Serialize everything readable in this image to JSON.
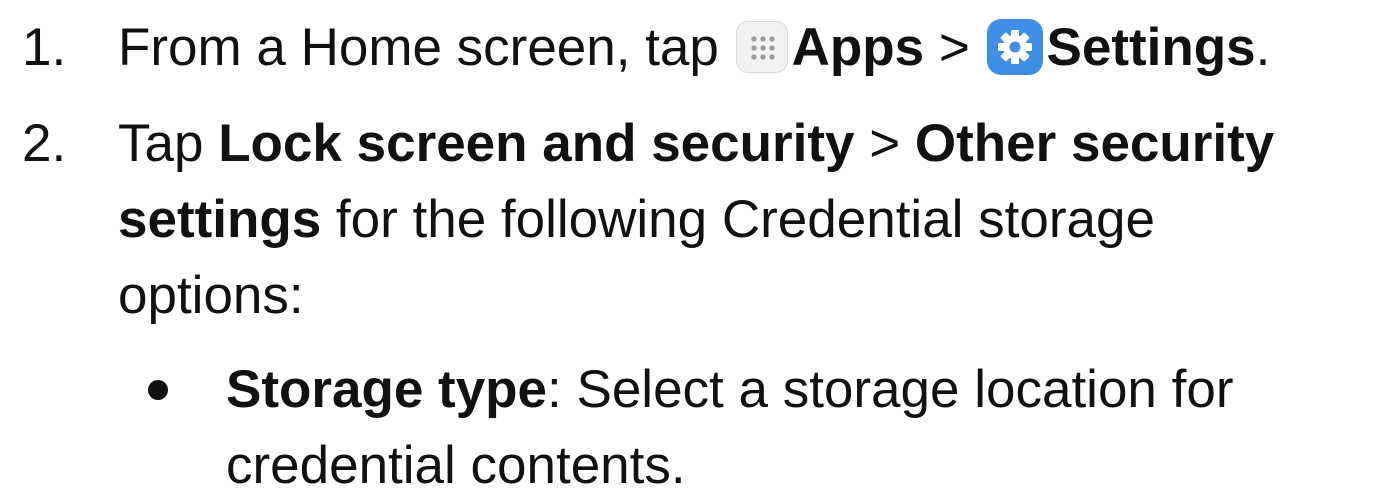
{
  "steps": [
    {
      "number": "1.",
      "intro": "From a Home screen, tap",
      "apps_label": "Apps",
      "separator": ">",
      "settings_label": "Settings",
      "end": "."
    },
    {
      "number": "2.",
      "intro": "Tap ",
      "bold_a": "Lock screen and security",
      "separator": ">",
      "bold_b1": "Other security",
      "bold_b2": "settings",
      "rest_1": " for the following Credential storage",
      "rest_2": "options:"
    }
  ],
  "bullets": [
    {
      "term": "Storage type",
      "desc_1": ": Select a storage location for",
      "desc_2": "credential contents."
    }
  ],
  "icons": {
    "apps": "apps-grid-icon",
    "settings": "settings-gear-icon",
    "settings_color": "#3d8ee4"
  }
}
